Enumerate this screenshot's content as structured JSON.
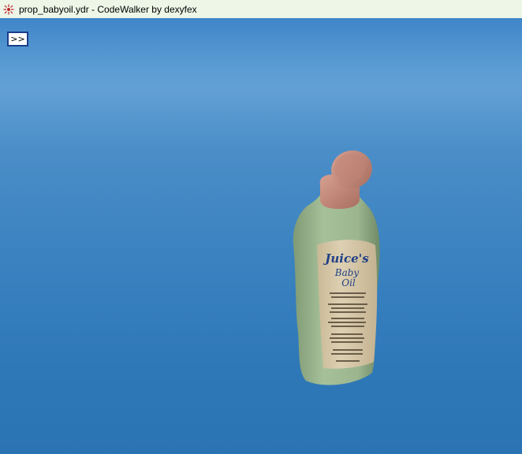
{
  "window": {
    "title": "prop_babyoil.ydr - CodeWalker by dexyfex",
    "icon": "codewalker-app-icon"
  },
  "viewport": {
    "toggle_button_label": ">>",
    "background_color": "#3a82c0"
  },
  "model": {
    "label_brand": "Juice's",
    "label_line1": "Baby",
    "label_line2": "Oil",
    "bottle_color": "#9db890",
    "cap_color": "#c98e7c",
    "label_color": "#d6c7a8",
    "text_color": "#1f3f86"
  }
}
